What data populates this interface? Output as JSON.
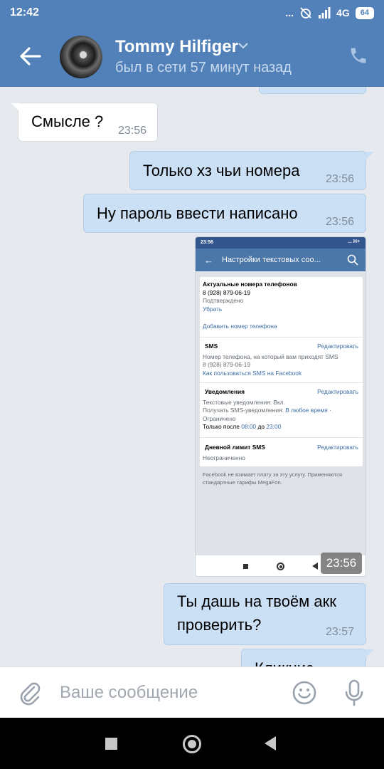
{
  "status_bar": {
    "time": "12:42",
    "dots": "...",
    "network": "4G",
    "battery": "64"
  },
  "header": {
    "contact_name": "Tommy Hilfiger",
    "last_seen": "был в сети 57 минут назад"
  },
  "messages": [
    {
      "text": "Смысле ?",
      "time": "23:56",
      "direction": "in"
    },
    {
      "text": "Только хз чьи номера",
      "time": "23:56",
      "direction": "out"
    },
    {
      "text": "Ну пароль ввести написано",
      "time": "23:56",
      "direction": "out"
    },
    {
      "text_line1": "Ты дашь на твоём акк",
      "text_line2": "проверить?",
      "time": "23:57",
      "direction": "out"
    },
    {
      "text": "Кликнис",
      "direction": "out"
    }
  ],
  "photo": {
    "time": "23:56",
    "status_time": "23:56",
    "status_icons": "... H+",
    "appbar_title": "Настройки текстовых соо...",
    "phones": {
      "title": "Актуальные номера телефонов",
      "number": "8 (928) 879-06-19",
      "state": "Подтверждено",
      "remove": "Убрать",
      "add": "Добавить номер телефона"
    },
    "sms": {
      "title": "SMS",
      "edit": "Редактировать",
      "desc": "Номер телефона, на который вам приходят SMS",
      "number": "8 (928) 879-06-19",
      "link": "Как пользоваться SMS на Facebook"
    },
    "notifications": {
      "title": "Уведомления",
      "edit": "Редактировать",
      "line1": "Текстовые уведомления: Вкл.",
      "line2_a": "Получать SMS-уведомления: ",
      "line2_b": "В любое время",
      "line2_c": " ·",
      "line3": "Ограничено",
      "line4_a": "Только после ",
      "line4_b": "08:00",
      "line4_c": " до ",
      "line4_d": "23:00"
    },
    "limit": {
      "title": "Дневной лимит SMS",
      "edit": "Редактировать",
      "value": "Неограниченно"
    },
    "footnote": "Facebook не взимает плату за эту услугу. Применяются стандартные тарифы MegaFon."
  },
  "input": {
    "placeholder": "Ваше сообщение"
  },
  "colors": {
    "header": "#5181b8",
    "bubble_out": "#cce0f5",
    "bubble_in": "#ffffff",
    "chat_bg": "#e6eaee",
    "link": "#3d6ea6"
  },
  "icons": [
    "back-arrow-icon",
    "chevron-down-icon",
    "phone-icon",
    "attach-icon",
    "emoji-icon",
    "mic-icon"
  ]
}
